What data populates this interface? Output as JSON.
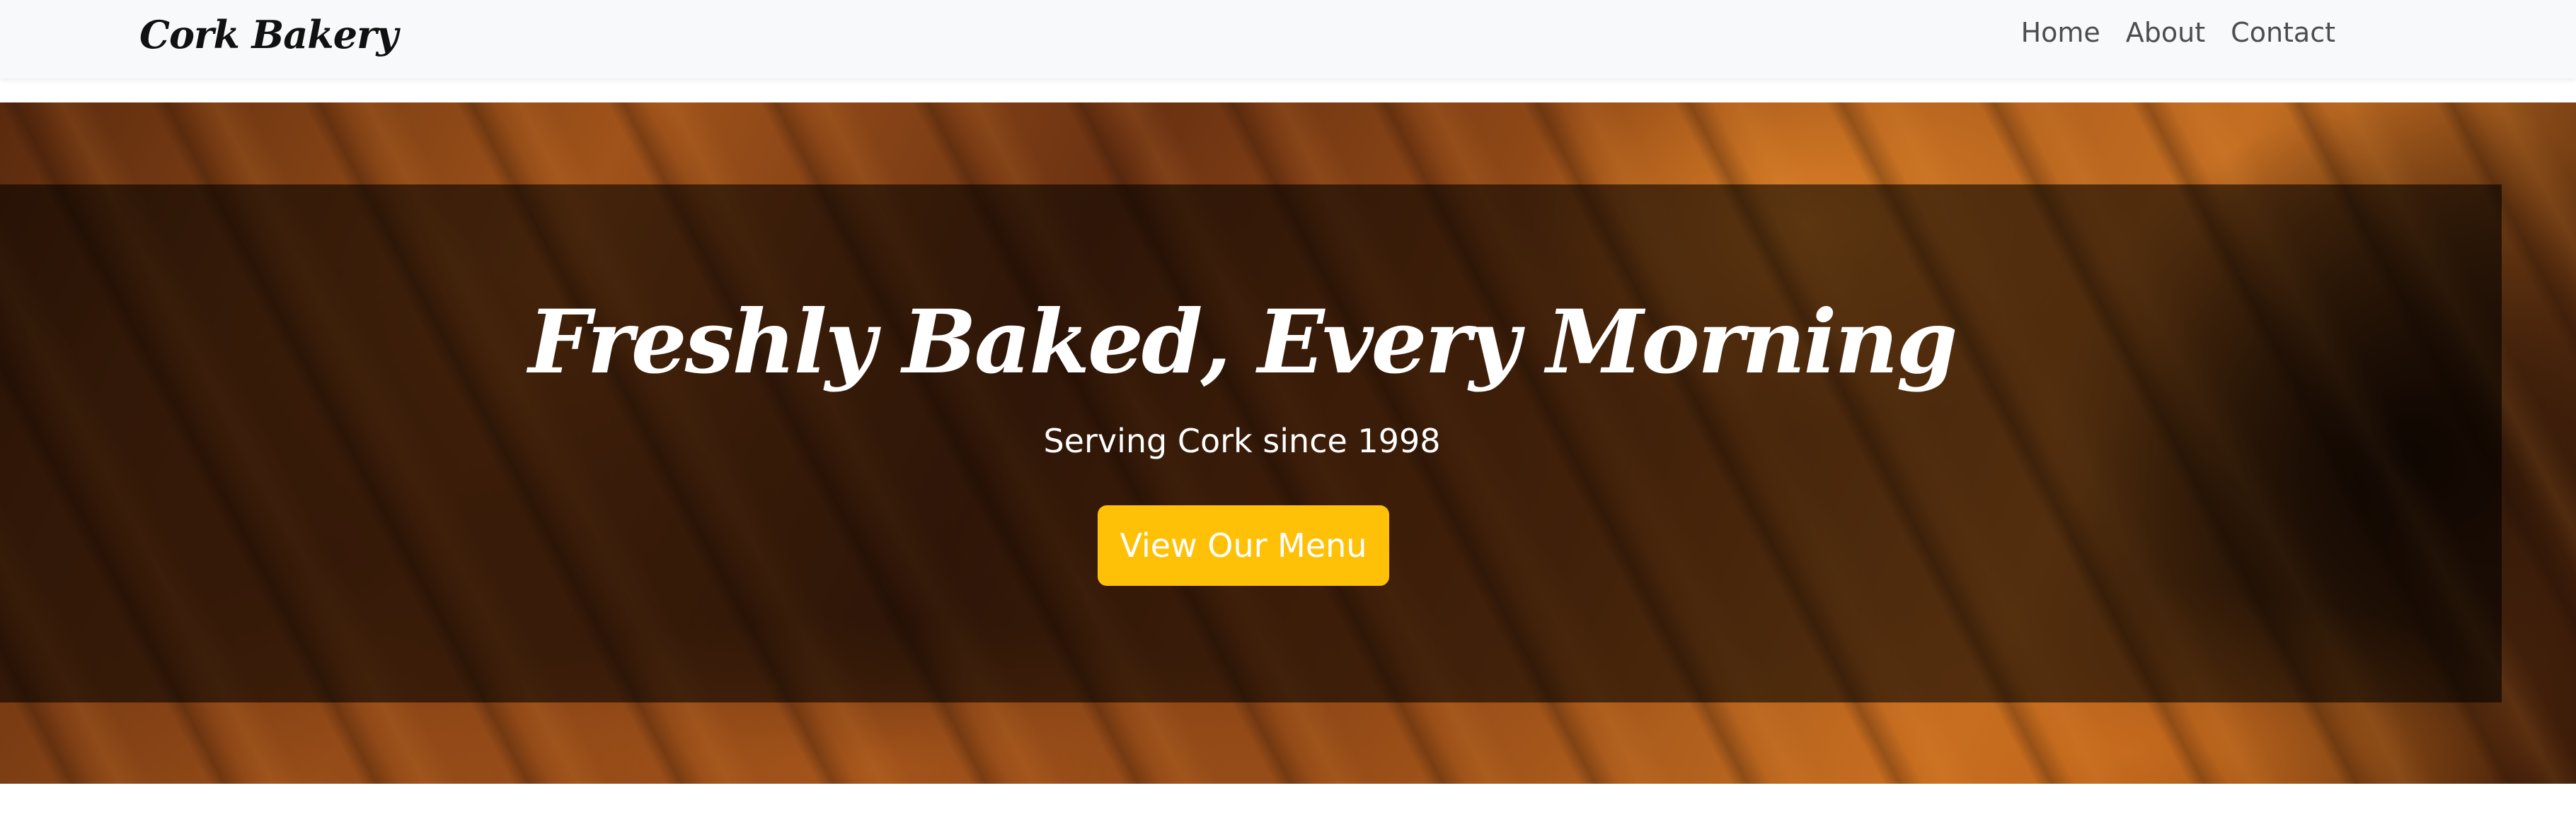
{
  "navbar": {
    "brand": "Cork Bakery",
    "links": [
      {
        "label": "Home"
      },
      {
        "label": "About"
      },
      {
        "label": "Contact"
      }
    ]
  },
  "hero": {
    "title": "Freshly Baked, Every Morning",
    "subtitle": "Serving Cork since 1998",
    "cta_label": "View Our Menu"
  },
  "colors": {
    "navbar_background": "#f8f9fa",
    "cta_background": "#ffc107",
    "cta_text": "#ffffff",
    "hero_text": "#ffffff",
    "brand_text": "#111111",
    "nav_link_text": "#4d4d4d"
  }
}
